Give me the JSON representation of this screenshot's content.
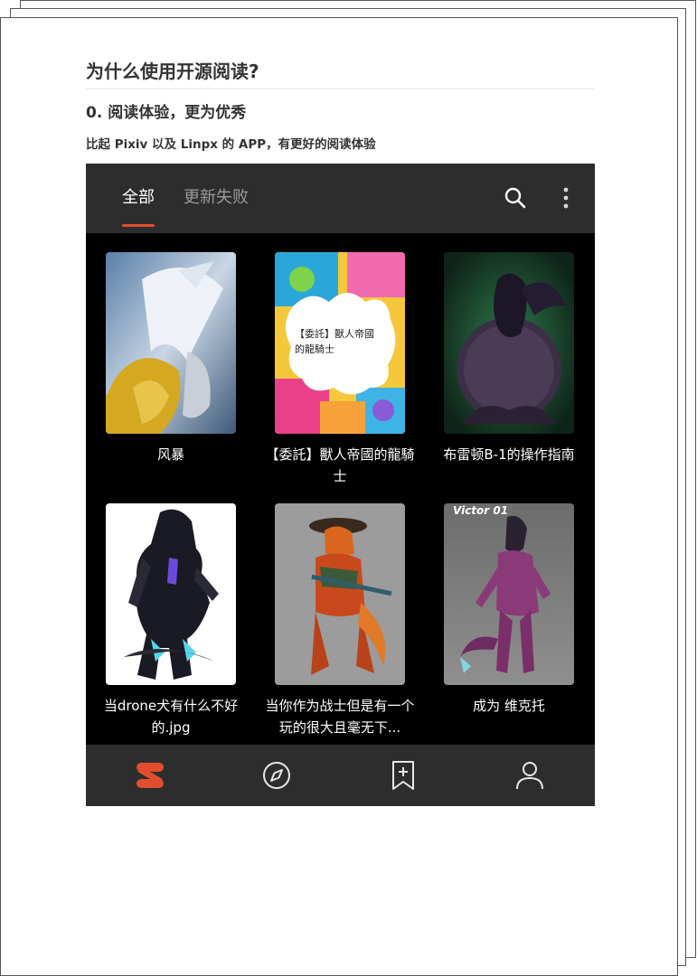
{
  "article": {
    "heading": "为什么使用开源阅读?",
    "subheading": "0. 阅读体验，更为优秀",
    "paragraph": "比起 Pixiv 以及 Linpx 的 APP，有更好的阅读体验"
  },
  "app": {
    "tabs": [
      {
        "label": "全部",
        "active": true
      },
      {
        "label": "更新失败",
        "active": false
      }
    ],
    "toolbar_icons": [
      "search-icon",
      "more-vert-icon"
    ],
    "books": [
      {
        "title": "风暴"
      },
      {
        "title": "【委託】獸人帝國的龍騎士",
        "cover_text": "【委託】獸人帝國\n的龍騎士"
      },
      {
        "title": "布雷顿B-1的操作指南"
      },
      {
        "title": "当drone犬有什么不好的.jpg"
      },
      {
        "title": "当你作为战士但是有一个玩的很大且毫无下..."
      },
      {
        "title": "成为 维克托",
        "cover_text": "Victor 01"
      }
    ],
    "bottom_nav": [
      "bookshelf-icon",
      "explore-icon",
      "bookmark-add-icon",
      "profile-icon"
    ],
    "colors": {
      "accent": "#e04e2d",
      "bar": "#2d2d2d",
      "background": "#000000"
    }
  }
}
